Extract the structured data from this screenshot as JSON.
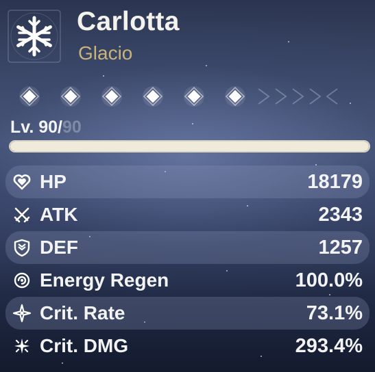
{
  "character": {
    "name": "Carlotta",
    "element": "Glacio",
    "element_icon": "snowflake-icon"
  },
  "resonance": {
    "nodes_unlocked": 6,
    "nodes_total": 6,
    "node_icon": "diamond-icon"
  },
  "level": {
    "prefix": "Lv. ",
    "current": "90",
    "separator": "/",
    "max": "90",
    "exp_progress": 1.0
  },
  "stats": [
    {
      "key": "hp",
      "label": "HP",
      "value": "18179",
      "icon": "heart-shield-icon"
    },
    {
      "key": "atk",
      "label": "ATK",
      "value": "2343",
      "icon": "crossed-swords-icon"
    },
    {
      "key": "def",
      "label": "DEF",
      "value": "1257",
      "icon": "shield-icon"
    },
    {
      "key": "energy-regen",
      "label": "Energy Regen",
      "value": "100.0%",
      "icon": "energy-swirl-icon"
    },
    {
      "key": "crit-rate",
      "label": "Crit. Rate",
      "value": "73.1%",
      "icon": "four-point-star-icon"
    },
    {
      "key": "crit-dmg",
      "label": "Crit. DMG",
      "value": "293.4%",
      "icon": "burst-star-icon"
    }
  ],
  "colors": {
    "element_gold": "#c9b37a",
    "text": "#f3f3f3",
    "level_max": "#7f8aa3"
  }
}
